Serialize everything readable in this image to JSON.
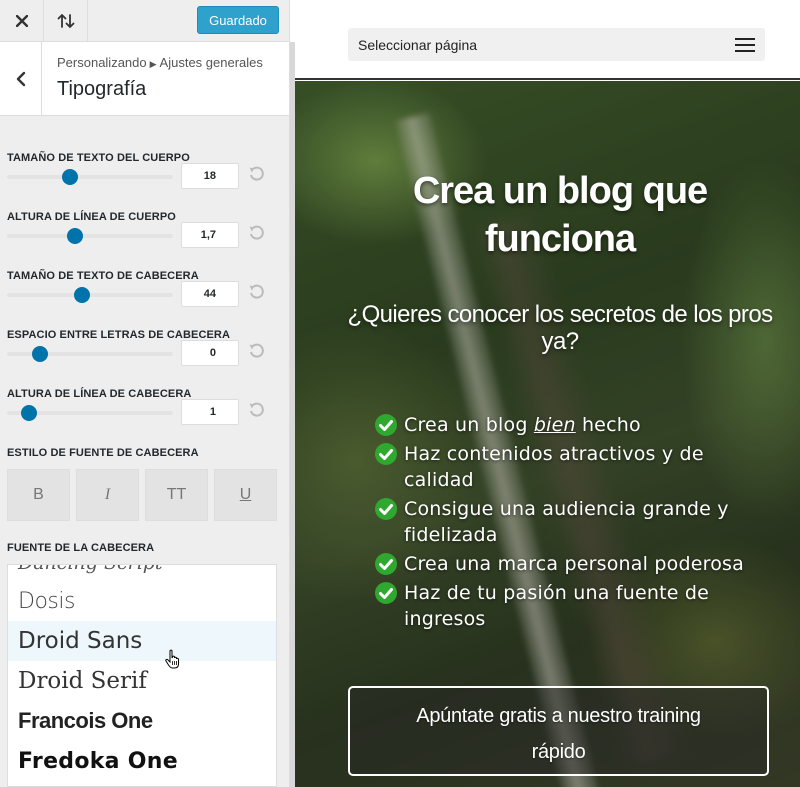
{
  "topbar": {
    "close_icon": "close-icon",
    "preview_icon": "sort-arrows-icon",
    "save_label": "Guardado"
  },
  "section": {
    "breadcrumb_parent": "Personalizando",
    "breadcrumb_current": "Ajustes generales",
    "title": "Tipografía"
  },
  "controls": [
    {
      "label": "TAMAÑO DE TEXTO DEL CUERPO",
      "value": "18",
      "slider_fraction": 0.38
    },
    {
      "label": "ALTURA DE LÍNEA DE CUERPO",
      "value": "1,7",
      "slider_fraction": 0.41
    },
    {
      "label": "TAMAÑO DE TEXTO DE CABECERA",
      "value": "44",
      "slider_fraction": 0.45
    },
    {
      "label": "ESPACIO ENTRE LETRAS DE CABECERA",
      "value": "0",
      "slider_fraction": 0.2
    },
    {
      "label": "ALTURA DE LÍNEA DE CABECERA",
      "value": "1",
      "slider_fraction": 0.13
    }
  ],
  "font_style": {
    "label": "ESTILO DE FUENTE DE CABECERA",
    "buttons": [
      "B",
      "I",
      "TT",
      "U"
    ]
  },
  "font_family": {
    "label": "FUENTE DE LA CABECERA",
    "options": [
      "Dancing Script",
      "Dosis",
      "Droid Sans",
      "Droid Serif",
      "Francois One",
      "Fredoka One"
    ],
    "hovered": "Droid Sans"
  },
  "preview": {
    "page_select_label": "Seleccionar página",
    "hero_title_line1": "Crea un blog que",
    "hero_title_line2": "funciona",
    "hero_subtitle": "¿Quieres conocer los secretos de los pros ya?",
    "bullets": [
      {
        "before": "Crea un blog ",
        "emph": "bien",
        "after": " hecho"
      },
      {
        "before": "Haz contenidos atractivos y de calidad",
        "emph": "",
        "after": ""
      },
      {
        "before": "Consigue una audiencia grande y fidelizada",
        "emph": "",
        "after": ""
      },
      {
        "before": "Crea una marca personal poderosa",
        "emph": "",
        "after": ""
      },
      {
        "before": "Haz de tu pasión una fuente de ingresos",
        "emph": "",
        "after": ""
      }
    ],
    "cta_line1": "Apúntate gratis a nuestro training",
    "cta_line2": "rápido"
  },
  "colors": {
    "accent": "#0073aa",
    "save_button": "#2ea2cc",
    "check_green": "#2ea82e"
  }
}
